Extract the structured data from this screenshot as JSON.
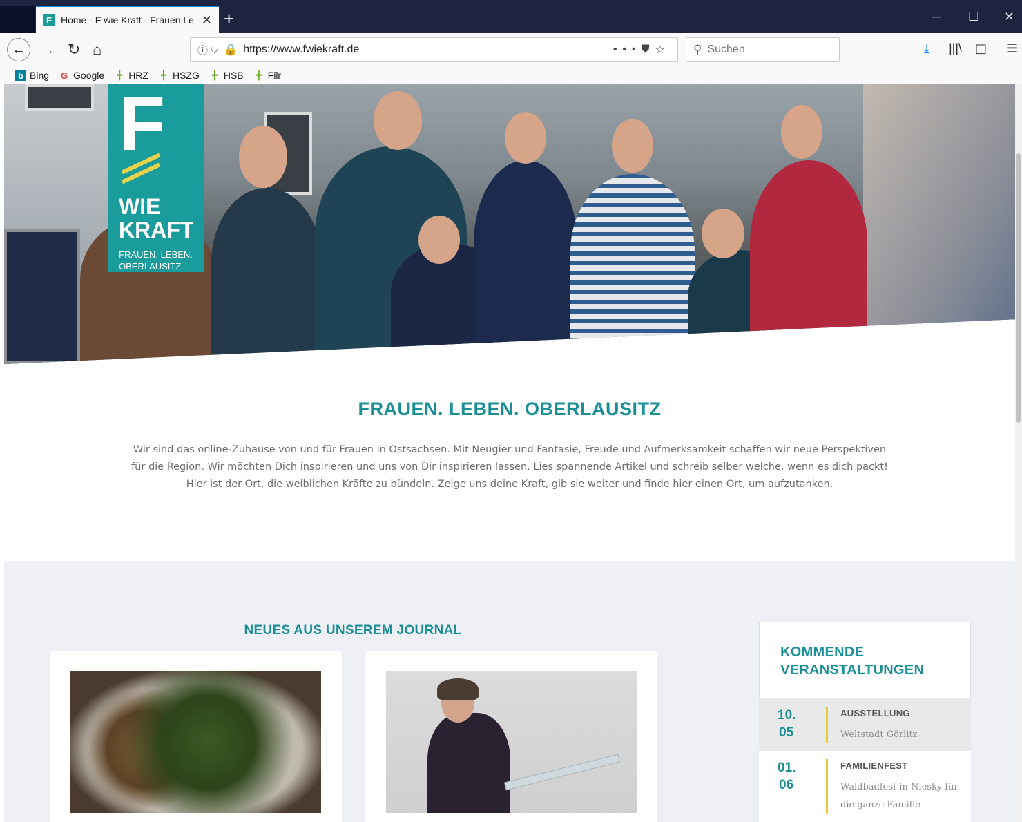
{
  "browser": {
    "tab_title": "Home - F wie Kraft - Frauen.Le",
    "favicon_letter": "F",
    "url": "https://www.fwiekraft.de",
    "search_placeholder": "Suchen",
    "bookmarks": [
      {
        "label": "Bing",
        "icon": "bing-icon"
      },
      {
        "label": "Google",
        "icon": "google-icon"
      },
      {
        "label": "HRZ",
        "icon": "folder-plant-icon"
      },
      {
        "label": "HSZG",
        "icon": "folder-plant-icon"
      },
      {
        "label": "HSB",
        "icon": "folder-plant-icon"
      },
      {
        "label": "Filr",
        "icon": "folder-plant-icon"
      }
    ]
  },
  "logo": {
    "letter": "F",
    "wie": "WIE",
    "kraft": "KRAFT",
    "tagline_1": "FRAUEN. LEBEN.",
    "tagline_2": "OBERLAUSITZ."
  },
  "intro": {
    "title": "FRAUEN. LEBEN. OBERLAUSITZ",
    "text": "Wir sind das online-Zuhause von und für Frauen in Ostsachsen. Mit Neugier und Fantasie, Freude und Aufmerksamkeit schaffen wir neue Perspektiven für die Region. Wir möchten Dich inspirieren und uns von Dir inspirieren lassen. Lies spannende Artikel und schreib selber welche, wenn es dich packt! Hier ist der Ort, die weiblichen Kräfte zu bündeln. Zeige uns deine Kraft, gib sie weiter und finde hier einen Ort, um aufzutanken."
  },
  "journal": {
    "title": "NEUES AUS UNSEREM JOURNAL"
  },
  "events": {
    "title_line1": "KOMMENDE",
    "title_line2": "VERANSTALTUNGEN",
    "items": [
      {
        "day": "10.",
        "month": "05",
        "type": "AUSSTELLUNG",
        "desc": "Weltstadt Görlitz"
      },
      {
        "day": "01.",
        "month": "06",
        "type": "FAMILIENFEST",
        "desc": "Waldbadfest in Niesky für die ganze Familie"
      }
    ]
  },
  "colors": {
    "brand_teal": "#1a9c9c",
    "accent_yellow": "#e6cc3a",
    "chrome_dark": "#1e2340"
  }
}
